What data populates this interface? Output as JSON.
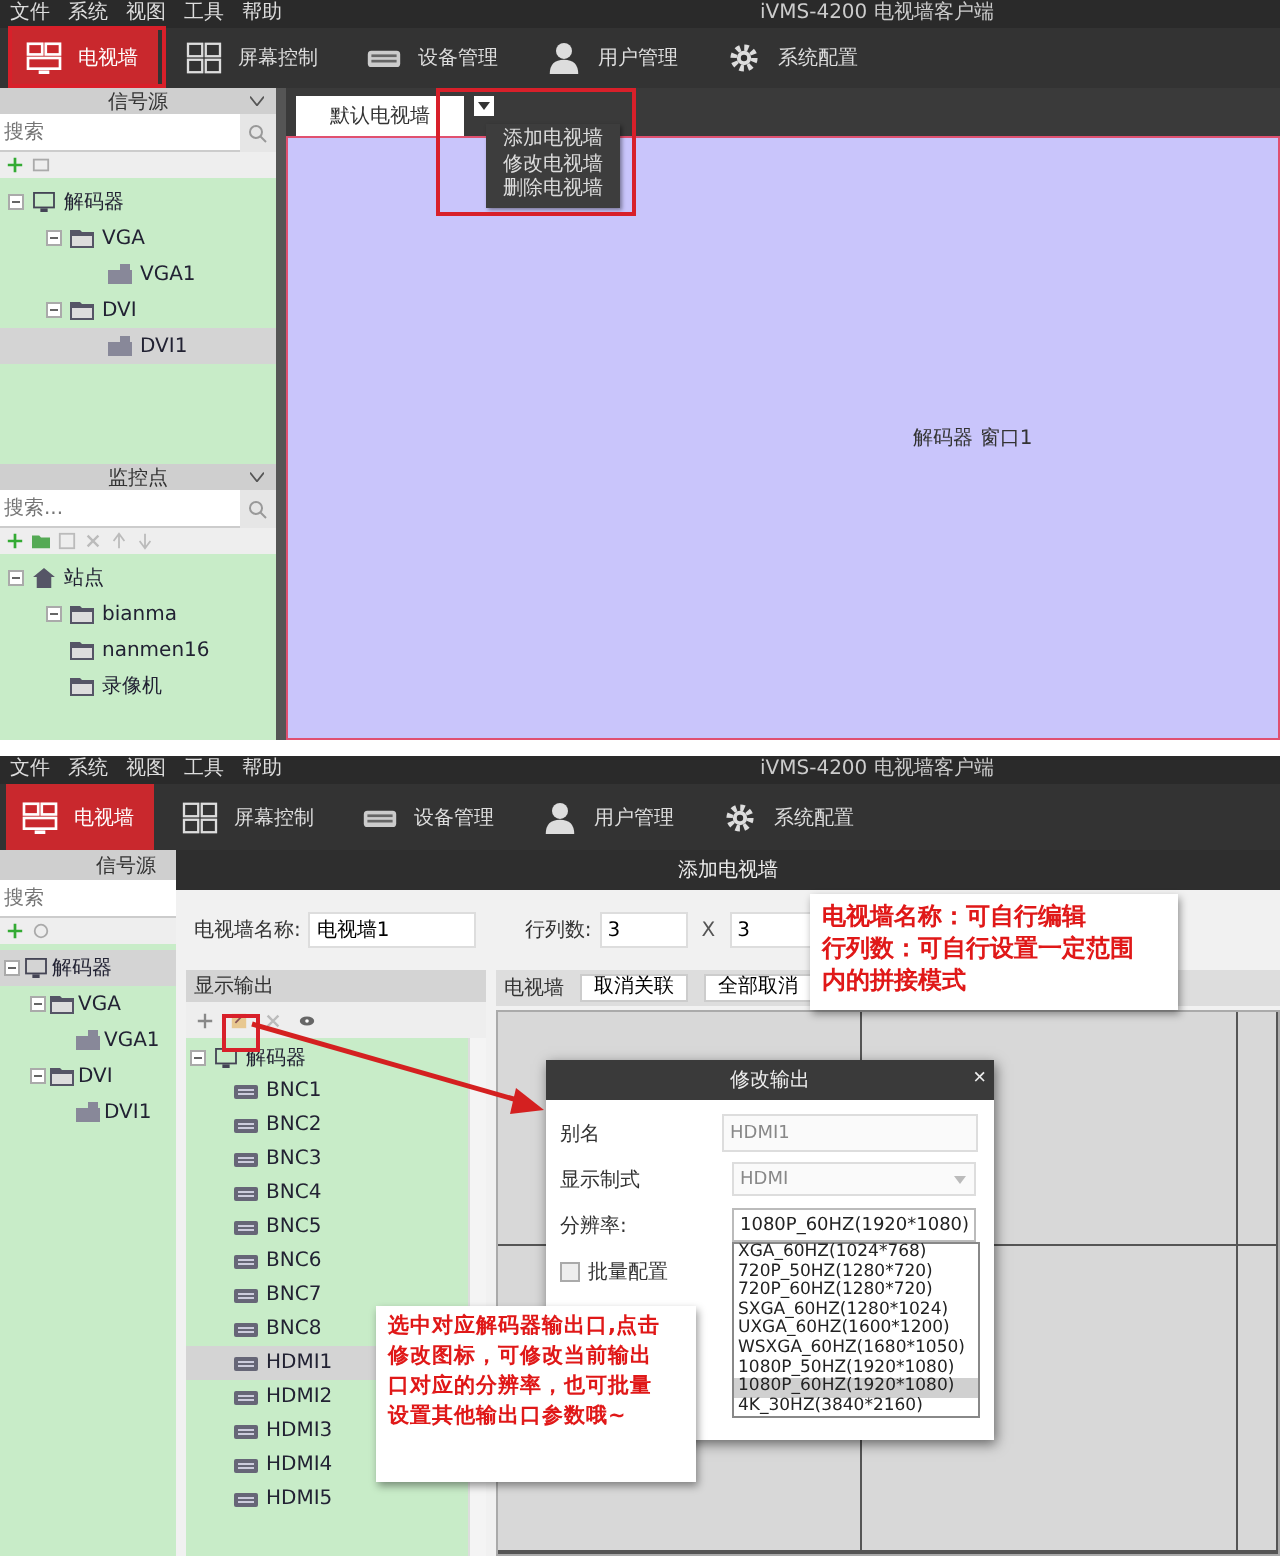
{
  "top_screen": {
    "menu": [
      "文件",
      "系统",
      "视图",
      "工具",
      "帮助"
    ],
    "title": "iVMS-4200 电视墙客户端",
    "nav": [
      {
        "label": "电视墙",
        "kind": "wall",
        "selected": true
      },
      {
        "label": "屏幕控制",
        "kind": "grid",
        "selected": false
      },
      {
        "label": "设备管理",
        "kind": "device",
        "selected": false
      },
      {
        "label": "用户管理",
        "kind": "user",
        "selected": false
      },
      {
        "label": "系统配置",
        "kind": "gear",
        "selected": false
      }
    ],
    "signal_panel": {
      "title": "信号源",
      "search_placeholder": "搜索",
      "tree": [
        {
          "label": "解码器",
          "kind": "decoder",
          "expandable": true,
          "selected": false,
          "children": [
            {
              "label": "VGA",
              "kind": "folder",
              "expandable": true,
              "selected": false,
              "children": [
                {
                  "label": "VGA1",
                  "kind": "channel",
                  "expandable": false,
                  "selected": false
                }
              ]
            },
            {
              "label": "DVI",
              "kind": "folder",
              "expandable": true,
              "selected": false,
              "children": [
                {
                  "label": "DVI1",
                  "kind": "channel",
                  "expandable": false,
                  "selected": true
                }
              ]
            }
          ]
        }
      ]
    },
    "camera_panel": {
      "title": "监控点",
      "search_placeholder": "搜索...",
      "tree": [
        {
          "label": "站点",
          "kind": "site",
          "expandable": true,
          "selected": false,
          "children": [
            {
              "label": "bianma",
              "kind": "folder",
              "expandable": true,
              "selected": false
            },
            {
              "label": "nanmen16",
              "kind": "folder",
              "expandable": false,
              "selected": false
            },
            {
              "label": "录像机",
              "kind": "folder",
              "expandable": false,
              "selected": false
            }
          ]
        }
      ]
    },
    "wall_tab": "默认电视墙",
    "dropdown_menu": [
      "添加电视墙",
      "修改电视墙",
      "删除电视墙"
    ],
    "canvas_label": "解码器 窗口1"
  },
  "bottom_screen": {
    "menu": [
      "文件",
      "系统",
      "视图",
      "工具",
      "帮助"
    ],
    "title": "iVMS-4200 电视墙客户端",
    "nav": [
      {
        "label": "电视墙",
        "kind": "wall",
        "selected": true
      },
      {
        "label": "屏幕控制",
        "kind": "grid",
        "selected": false
      },
      {
        "label": "设备管理",
        "kind": "device",
        "selected": false
      },
      {
        "label": "用户管理",
        "kind": "user",
        "selected": false
      },
      {
        "label": "系统配置",
        "kind": "gear",
        "selected": false
      }
    ],
    "signal_panel": {
      "title": "信号源",
      "search_placeholder": "搜索",
      "tree": [
        {
          "label": "解码器",
          "kind": "decoder",
          "expandable": true,
          "selected": true,
          "children": [
            {
              "label": "VGA",
              "kind": "folder",
              "expandable": true,
              "selected": false,
              "children": [
                {
                  "label": "VGA1",
                  "kind": "channel",
                  "expandable": false,
                  "selected": false
                }
              ]
            },
            {
              "label": "DVI",
              "kind": "folder",
              "expandable": true,
              "selected": false,
              "children": [
                {
                  "label": "DVI1",
                  "kind": "channel",
                  "expandable": false,
                  "selected": false
                }
              ]
            }
          ]
        }
      ]
    },
    "page_title": "添加电视墙",
    "form": {
      "name_label": "电视墙名称:",
      "name_value": "电视墙1",
      "grid_label": "行列数:",
      "rows": "3",
      "times": "X",
      "cols": "3"
    },
    "output_panel": {
      "title": "显示输出",
      "tree": [
        {
          "label": "解码器",
          "kind": "decoder",
          "expandable": true,
          "selected": false,
          "children": [
            {
              "label": "BNC1",
              "kind": "port",
              "expandable": false,
              "selected": false
            },
            {
              "label": "BNC2",
              "kind": "port",
              "expandable": false,
              "selected": false
            },
            {
              "label": "BNC3",
              "kind": "port",
              "expandable": false,
              "selected": false
            },
            {
              "label": "BNC4",
              "kind": "port",
              "expandable": false,
              "selected": false
            },
            {
              "label": "BNC5",
              "kind": "port",
              "expandable": false,
              "selected": false
            },
            {
              "label": "BNC6",
              "kind": "port",
              "expandable": false,
              "selected": false
            },
            {
              "label": "BNC7",
              "kind": "port",
              "expandable": false,
              "selected": false
            },
            {
              "label": "BNC8",
              "kind": "port",
              "expandable": false,
              "selected": false
            },
            {
              "label": "HDMI1",
              "kind": "port",
              "expandable": false,
              "selected": true
            },
            {
              "label": "HDMI2",
              "kind": "port",
              "expandable": false,
              "selected": false
            },
            {
              "label": "HDMI3",
              "kind": "port",
              "expandable": false,
              "selected": false
            },
            {
              "label": "HDMI4",
              "kind": "port",
              "expandable": false,
              "selected": false
            },
            {
              "label": "HDMI5",
              "kind": "port",
              "expandable": false,
              "selected": false
            }
          ]
        }
      ]
    },
    "wall_toolbar": {
      "label": "电视墙",
      "buttons": [
        "取消关联",
        "全部取消"
      ]
    },
    "dialog": {
      "title": "修改输出",
      "close": "×",
      "fields": [
        {
          "label": "别名",
          "kind": "text",
          "value": "HDMI1",
          "disabled": true
        },
        {
          "label": "显示制式",
          "kind": "select",
          "value": "HDMI",
          "disabled": true
        },
        {
          "label": "分辨率:",
          "kind": "select",
          "value": "1080P_60HZ(1920*1080)",
          "disabled": false,
          "options": [
            {
              "label": "XGA_60HZ(1024*768)",
              "selected": false
            },
            {
              "label": "720P_50HZ(1280*720)",
              "selected": false
            },
            {
              "label": "720P_60HZ(1280*720)",
              "selected": false
            },
            {
              "label": "SXGA_60HZ(1280*1024)",
              "selected": false
            },
            {
              "label": "UXGA_60HZ(1600*1200)",
              "selected": false
            },
            {
              "label": "WSXGA_60HZ(1680*1050)",
              "selected": false
            },
            {
              "label": "1080P_50HZ(1920*1080)",
              "selected": false
            },
            {
              "label": "1080P_60HZ(1920*1080)",
              "selected": true
            },
            {
              "label": "4K_30HZ(3840*2160)",
              "selected": false
            }
          ]
        }
      ],
      "batch": {
        "label": "批量配置",
        "checked": false
      }
    },
    "notes": [
      {
        "lines": [
          "电视墙名称：可自行编辑",
          "行列数：可自行设置一定范围",
          "内的拼接模式"
        ]
      },
      {
        "lines": [
          "选中对应解码器输出口,点击",
          "修改图标，可修改当前输出",
          "口对应的分辨率，也可批量",
          "设置其他输出口参数哦~"
        ]
      }
    ]
  }
}
